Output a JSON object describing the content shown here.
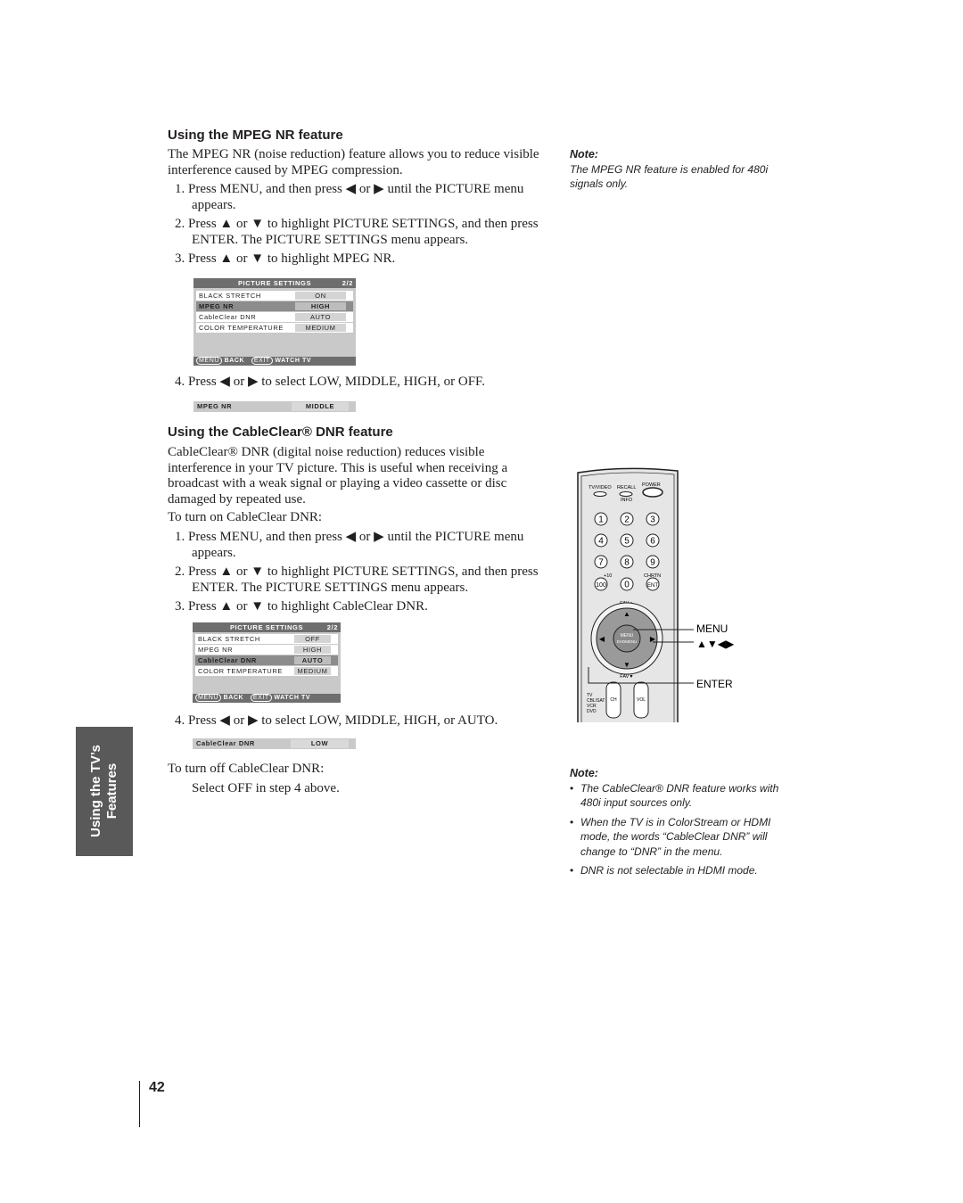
{
  "mpeg": {
    "heading": "Using the MPEG NR feature",
    "intro": "The MPEG NR (noise reduction) feature allows you to reduce visible interference caused by MPEG compression.",
    "steps": [
      "1. Press MENU, and then press ◀ or ▶ until the PICTURE menu appears.",
      "2. Press ▲ or ▼ to highlight PICTURE SETTINGS, and then press ENTER. The PICTURE SETTINGS menu appears.",
      "3. Press ▲ or ▼ to highlight MPEG NR.",
      "4. Press ◀ or ▶ to select LOW, MIDDLE, HIGH, or OFF."
    ],
    "menu": {
      "title": "PICTURE SETTINGS",
      "page": "2/2",
      "rows": [
        {
          "label": "BLACK STRETCH",
          "value": "ON"
        },
        {
          "label": "MPEG NR",
          "value": "HIGH"
        },
        {
          "label": "CableClear DNR",
          "value": "AUTO"
        },
        {
          "label": "COLOR TEMPERATURE",
          "value": "MEDIUM"
        }
      ],
      "foot_menu": "MENU",
      "foot_back": "BACK",
      "foot_exit": "EXIT",
      "foot_watch": "WATCH TV"
    },
    "bar": {
      "label": "MPEG NR",
      "value": "MIDDLE"
    },
    "note_title": "Note:",
    "note": "The MPEG NR feature is enabled for 480i signals only."
  },
  "dnr": {
    "heading": "Using the CableClear® DNR feature",
    "intro": "CableClear® DNR (digital noise reduction) reduces visible interference in your TV picture. This is useful when receiving a broadcast with a weak signal or playing a video cassette or disc damaged by repeated use.",
    "turn_on": "To turn on CableClear DNR:",
    "steps": [
      "1. Press MENU, and then press ◀ or ▶ until the PICTURE menu appears.",
      "2. Press ▲ or ▼ to highlight PICTURE SETTINGS, and then press ENTER. The PICTURE SETTINGS menu appears.",
      "3. Press ▲ or ▼ to highlight CableClear DNR.",
      "4. Press ◀ or ▶ to select LOW, MIDDLE, HIGH, or AUTO."
    ],
    "menu": {
      "title": "PICTURE SETTINGS",
      "page": "2/2",
      "rows": [
        {
          "label": "BLACK STRETCH",
          "value": "OFF"
        },
        {
          "label": "MPEG NR",
          "value": "HIGH"
        },
        {
          "label": "CableClear DNR",
          "value": "AUTO"
        },
        {
          "label": "COLOR TEMPERATURE",
          "value": "MEDIUM"
        }
      ],
      "foot_menu": "MENU",
      "foot_back": "BACK",
      "foot_exit": "EXIT",
      "foot_watch": "WATCH TV"
    },
    "bar": {
      "label": "CableClear DNR",
      "value": "LOW"
    },
    "turn_off": "To turn off CableClear DNR:",
    "turn_off_step": "Select OFF in step 4 above.",
    "note_title": "Note:",
    "notes": [
      "The CableClear® DNR feature works with 480i input sources only.",
      "When the TV is in ColorStream or HDMI mode, the words “CableClear DNR” will change to “DNR” in the menu.",
      "DNR is not selectable in HDMI mode."
    ]
  },
  "remote": {
    "labels": {
      "tvvideo": "TV/VIDEO",
      "recall": "RECALL",
      "info": "INFO",
      "power": "POWER",
      "plus10": "+10",
      "chrtn": "CHRTN",
      "k100": "100",
      "ent": "ENT",
      "fav_up": "FAV▲",
      "fav_down": "FAV▼",
      "menu": "MENU",
      "dvdmenu": "DVDMENU",
      "ch": "CH",
      "vol": "VOL",
      "tv": "TV",
      "cbl": "CBL/SAT",
      "vcr": "VCR",
      "dvd": "DVD"
    },
    "digits": [
      "1",
      "2",
      "3",
      "4",
      "5",
      "6",
      "7",
      "8",
      "9",
      "0"
    ],
    "callout_menu": "MENU",
    "callout_arrows": "▲▼◀▶",
    "callout_enter": "ENTER"
  },
  "side_tab": {
    "line1": "Using the TV’s",
    "line2": "Features"
  },
  "page_number": "42"
}
